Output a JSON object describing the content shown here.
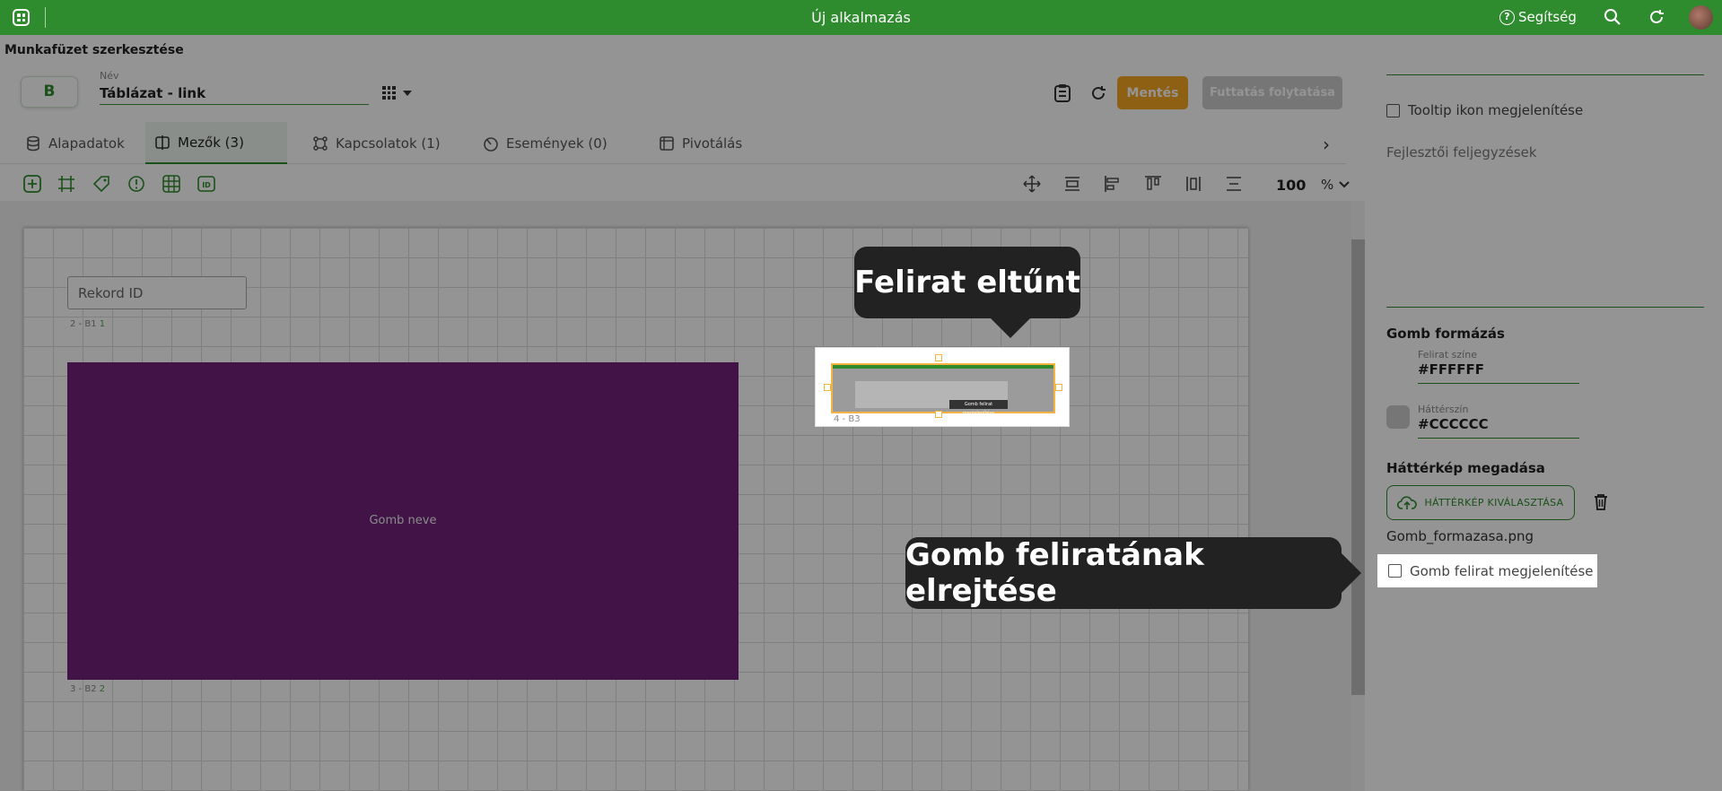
{
  "topbar": {
    "title": "Új alkalmazás",
    "help_label": "Segítség",
    "help_icon_glyph": "?",
    "brand_color": "#2e8b2e"
  },
  "header": {
    "page_title": "Munkafüzet szerkesztése",
    "badge": "B",
    "name_label": "Név",
    "name_value": "Táblázat - link",
    "save_label": "Mentés",
    "run_label": "Futtatás folytatása",
    "save_color": "#f5a623"
  },
  "tabs": [
    {
      "label": "Alapadatok",
      "icon": "database-icon"
    },
    {
      "label": "Mezők (3)",
      "icon": "fields-icon",
      "active": true
    },
    {
      "label": "Kapcsolatok (1)",
      "icon": "relations-icon"
    },
    {
      "label": "Események (0)",
      "icon": "events-icon"
    },
    {
      "label": "Pivotálás",
      "icon": "pivot-icon"
    }
  ],
  "toolbar": {
    "zoom_value": "100",
    "zoom_unit": "%"
  },
  "canvas": {
    "rekord_field": "Rekord ID",
    "rekord_label": "2 - B1",
    "rekord_label_num": "1",
    "button_text": "Gomb neve",
    "button_label": "3 - B2",
    "button_label_num": "2",
    "button_color": "#71227a",
    "thumb_label": "4 - B3",
    "thumb_tip": "Gomb felirat megjelenítése"
  },
  "panel": {
    "tooltip_check": "Tooltip ikon megjelenítése",
    "notes_label": "Fejlesztői feljegyzések",
    "format_heading": "Gomb formázás",
    "text_color_label": "Felirat színe",
    "text_color_value": "#FFFFFF",
    "bg_color_label": "Háttérszín",
    "bg_color_value": "#CCCCCC",
    "bgimage_heading": "Háttérkép megadása",
    "upload_label": "HÁTTÉRKÉP KIVÁLASZTÁSA",
    "file_name": "Gomb_formazasa.png",
    "show_label_check": "Gomb felirat megjelenítése"
  },
  "callouts": {
    "label_gone": "Felirat eltűnt",
    "hide_label": "Gomb feliratának elrejtése"
  }
}
